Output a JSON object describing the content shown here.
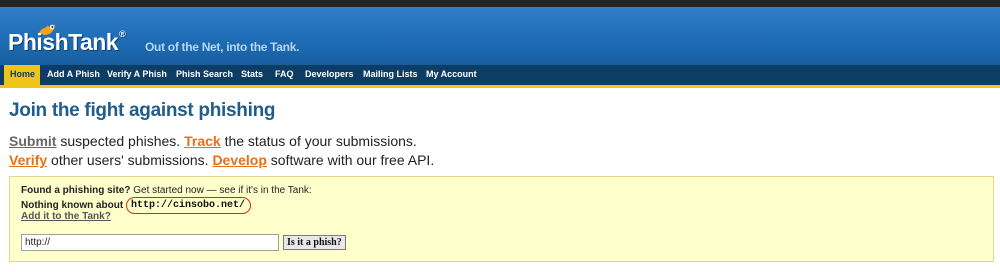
{
  "header": {
    "logo_text": "PhishTank",
    "logo_mark": "®",
    "tagline": "Out of the Net, into the Tank."
  },
  "nav": {
    "items": [
      {
        "label": "Home",
        "active": true
      },
      {
        "label": "Add A Phish"
      },
      {
        "label": "Verify A Phish"
      },
      {
        "label": "Phish Search"
      },
      {
        "label": "Stats"
      },
      {
        "label": "FAQ"
      },
      {
        "label": "Developers"
      },
      {
        "label": "Mailing Lists"
      },
      {
        "label": "My Account"
      }
    ]
  },
  "main": {
    "title": "Join the fight against phishing",
    "line1": {
      "link1": "Submit",
      "text1": " suspected phishes. ",
      "link2": "Track",
      "text2": " the status of your submissions."
    },
    "line2": {
      "link1": "Verify",
      "text1": " other users' submissions. ",
      "link2": "Develop",
      "text2": " software with our free API."
    }
  },
  "lookup": {
    "found_label": "Found a phishing site?",
    "found_text": " Get started now — see if it's in the Tank:",
    "nothing_label": "Nothing known about",
    "url": "http://cinsobo.net/",
    "add_link": "Add it to the Tank?",
    "input_value": "http://",
    "button_label": "Is it a phish?"
  },
  "colors": {
    "header_blue": "#1f6db6",
    "nav_dark": "#0d3d64",
    "accent_yellow": "#f0c419",
    "link_orange": "#e86f16",
    "highlight_box": "#ffffcc",
    "circle_red": "#d42a1a"
  },
  "icons": {
    "logo_flame": "flame-icon"
  }
}
